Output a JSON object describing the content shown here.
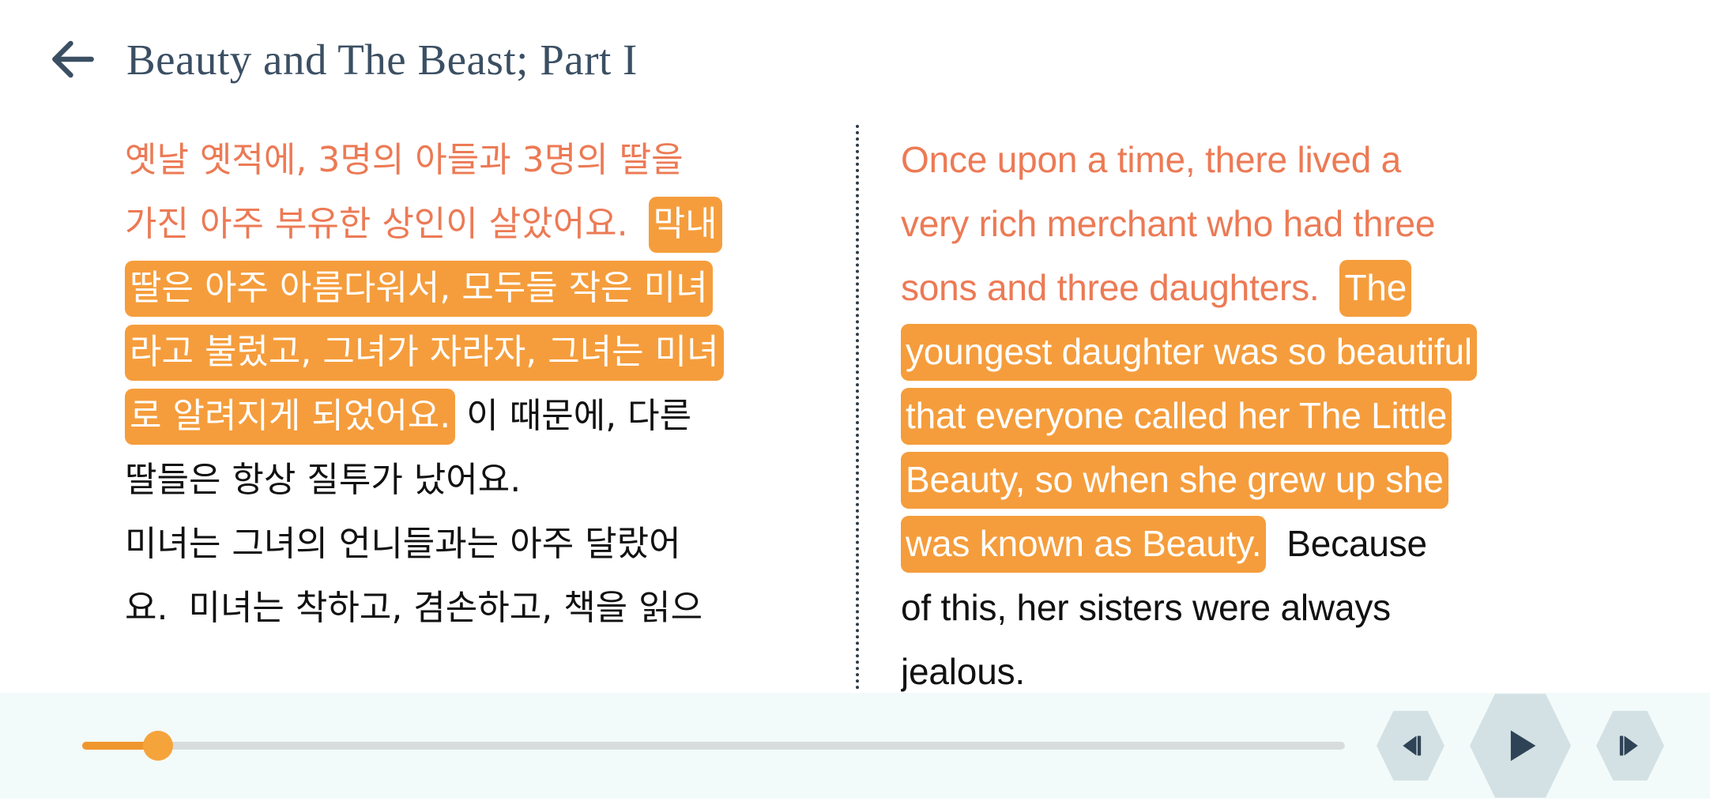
{
  "header": {
    "back_icon": "arrow-left-icon",
    "title": "Beauty and The Beast; Part I"
  },
  "colors": {
    "title": "#3b4f63",
    "read_text": "#ec7a55",
    "highlight_bg": "#f59d3c",
    "highlight_text": "#ffffff",
    "plain_text": "#111111",
    "slider_fill": "#f0962e",
    "slider_thumb": "#f5a43c",
    "slider_track": "#d8dcdd",
    "button_bg": "#d3e1e4",
    "button_icon": "#2f4356",
    "player_bg": "#f3fafa"
  },
  "reader": {
    "divider": "dotted-vertical-divider",
    "korean": {
      "language": "Korean",
      "lines": [
        [
          {
            "t": "옛날 옛적에, 3명의 아들과 3명의 딸을",
            "s": "read"
          }
        ],
        [
          {
            "t": "가진 아주 부유한 상인이 살았어요.",
            "s": "read"
          },
          {
            "t": "gap",
            "s": "gap"
          },
          {
            "t": "막내",
            "s": "hl"
          }
        ],
        [
          {
            "t": "딸은 아주 아름다워서, 모두들 작은 미녀",
            "s": "hl"
          }
        ],
        [
          {
            "t": "라고 불렀고, 그녀가 자라자, 그녀는 미녀",
            "s": "hl"
          }
        ],
        [
          {
            "t": "로 알려지게 되었어요.",
            "s": "hl"
          },
          {
            "t": "gap-sm",
            "s": "gap"
          },
          {
            "t": "이 때문에, 다른",
            "s": "plain"
          }
        ],
        [
          {
            "t": "딸들은 항상 질투가 났어요.",
            "s": "plain"
          }
        ],
        [
          {
            "t": "미녀는 그녀의 언니들과는 아주 달랐어",
            "s": "plain"
          }
        ],
        [
          {
            "t": "요.",
            "s": "plain"
          },
          {
            "t": "gap",
            "s": "gap"
          },
          {
            "t": "미녀는 착하고, 겸손하고, 책을 읽으",
            "s": "plain"
          }
        ]
      ]
    },
    "english": {
      "language": "English",
      "lines": [
        [
          {
            "t": "Once upon a time, there lived a",
            "s": "read"
          }
        ],
        [
          {
            "t": "very rich merchant who had three",
            "s": "read"
          }
        ],
        [
          {
            "t": "sons and three daughters.",
            "s": "read"
          },
          {
            "t": "gap",
            "s": "gap"
          },
          {
            "t": "The",
            "s": "hl"
          }
        ],
        [
          {
            "t": "youngest daughter was so beautiful",
            "s": "hl"
          }
        ],
        [
          {
            "t": "that everyone called her The Little",
            "s": "hl"
          }
        ],
        [
          {
            "t": "Beauty, so when she grew up she",
            "s": "hl"
          }
        ],
        [
          {
            "t": "was known as Beauty.",
            "s": "hl"
          },
          {
            "t": "gap",
            "s": "gap"
          },
          {
            "t": "Because",
            "s": "plain"
          }
        ],
        [
          {
            "t": "of this, her sisters were always",
            "s": "plain"
          }
        ],
        [
          {
            "t": "jealous.",
            "s": "plain"
          }
        ]
      ]
    }
  },
  "player": {
    "progress_percent": 6,
    "slider_name": "playback-progress-slider",
    "buttons": [
      {
        "name": "previous-sentence-button",
        "icon": "skip-back-icon",
        "label": "Previous"
      },
      {
        "name": "play-button",
        "icon": "play-icon",
        "label": "Play"
      },
      {
        "name": "next-sentence-button",
        "icon": "skip-forward-icon",
        "label": "Next"
      }
    ]
  }
}
